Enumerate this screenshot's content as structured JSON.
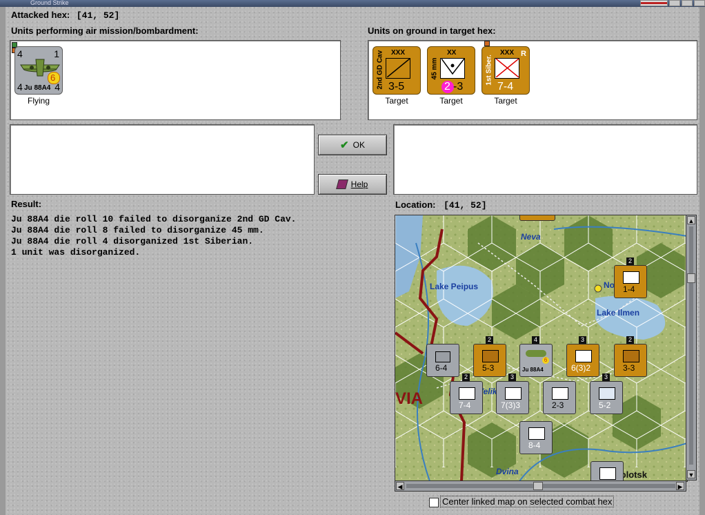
{
  "window": {
    "title": "Ground Strike"
  },
  "attacked_hex": {
    "label": "Attacked hex:",
    "value": "[41, 52]"
  },
  "air_units": {
    "heading": "Units performing air mission/bombardment:",
    "units": [
      {
        "name": "Ju 88A4",
        "top_left": "4",
        "top_right": "1",
        "bottom_left": "4",
        "bottom_right": "4",
        "badge": "6",
        "status": "Flying"
      }
    ]
  },
  "ground_units": {
    "heading": "Units on ground in target hex:",
    "units": [
      {
        "name": "2nd GD Cav",
        "size": "XXX",
        "strength": "3-5",
        "status": "Target",
        "type": "cavalry"
      },
      {
        "name": "45 mm",
        "size": "XX",
        "strength": "2-3",
        "strength_badge": "2",
        "strength_rest": "-3",
        "status": "Target",
        "type": "anti-tank"
      },
      {
        "name": "1st Siber.",
        "size": "XXX",
        "strength": "7-4",
        "status": "Target",
        "reserve_flag": "R",
        "type": "infantry"
      }
    ]
  },
  "buttons": {
    "ok": "OK",
    "help": "Help"
  },
  "result": {
    "label": "Result:",
    "lines": [
      "Ju 88A4 die roll 10 failed to disorganize 2nd GD Cav.",
      "Ju 88A4 die roll 8 failed to disorganize 45 mm.",
      "Ju 88A4 die roll 4 disorganized 1st Siberian.",
      "1 unit was disorganized."
    ]
  },
  "location": {
    "label": "Location:",
    "value": "[41, 52]"
  },
  "map": {
    "labels": {
      "neva": "Neva",
      "lake_peipus": "Lake Peipus",
      "novgorod": "Novgorod",
      "lake_ilmen": "Lake Ilmen",
      "via": "VIA",
      "velik": "Velik",
      "dvina": "Dvina",
      "polotsk": "Polotsk"
    },
    "counters": [
      {
        "id": "c1",
        "strength": "1-4",
        "stack": "2",
        "color": "gold"
      },
      {
        "id": "c2",
        "strength": "6-4",
        "color": "grey"
      },
      {
        "id": "c3",
        "strength": "5-3",
        "stack": "2",
        "color": "gold"
      },
      {
        "id": "c4",
        "strength": "6(3)2",
        "stack": "3",
        "color": "gold"
      },
      {
        "id": "c5",
        "strength": "3-3",
        "stack": "2",
        "color": "gold"
      },
      {
        "id": "c6",
        "strength": "7-4",
        "stack": "2",
        "color": "grey"
      },
      {
        "id": "c7",
        "strength": "7(3)3",
        "stack": "3",
        "color": "grey"
      },
      {
        "id": "c8",
        "strength": "2-3",
        "color": "grey"
      },
      {
        "id": "c9",
        "strength": "5-2",
        "stack": "3",
        "color": "grey"
      },
      {
        "id": "c10",
        "strength": "8-4",
        "color": "grey"
      }
    ],
    "air_counter": {
      "name": "Ju 88A4",
      "stack": "4",
      "badge": "6"
    }
  },
  "center_option": {
    "label": "Center linked map on selected combat hex",
    "checked": false
  },
  "colors": {
    "gold_counter": "#c88a12",
    "grey_counter": "#9a9ea4",
    "attack_badge": "#ff1fd0"
  }
}
